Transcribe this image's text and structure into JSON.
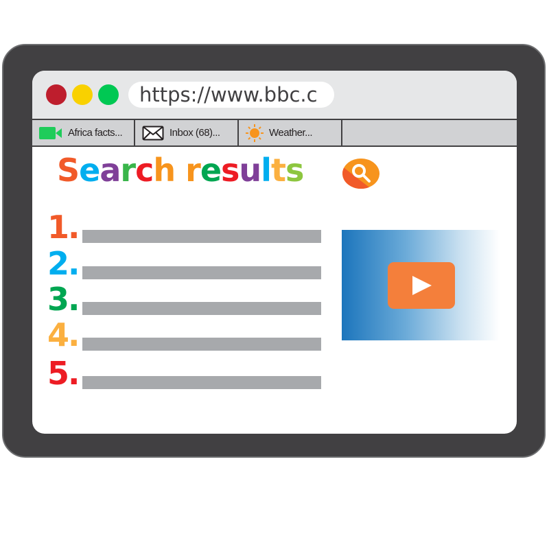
{
  "window": {
    "controls": [
      {
        "name": "close",
        "color": "#be1e2d"
      },
      {
        "name": "minimize",
        "color": "#f9d100"
      },
      {
        "name": "maximize",
        "color": "#00c853"
      }
    ],
    "url": "https://www.bbc.c"
  },
  "tabs": [
    {
      "icon": "video-camera-icon",
      "label": "Africa facts...",
      "icon_color": "#1fcc5a"
    },
    {
      "icon": "envelope-icon",
      "label": "Inbox (68)...",
      "icon_color": "#231f20"
    },
    {
      "icon": "sun-icon",
      "label": "Weather...",
      "icon_color": "#f7941d"
    }
  ],
  "heading": {
    "text": "Search results",
    "letters": [
      {
        "ch": "S",
        "color": "#f15a29"
      },
      {
        "ch": "e",
        "color": "#00aeef"
      },
      {
        "ch": "a",
        "color": "#7f3f98"
      },
      {
        "ch": "r",
        "color": "#39b54a"
      },
      {
        "ch": "c",
        "color": "#ed1c24"
      },
      {
        "ch": "h",
        "color": "#f7941d"
      },
      {
        "ch": " ",
        "color": "#ffffff"
      },
      {
        "ch": "r",
        "color": "#f7941d"
      },
      {
        "ch": "e",
        "color": "#00a651"
      },
      {
        "ch": "s",
        "color": "#ed1c24"
      },
      {
        "ch": "u",
        "color": "#7f3f98"
      },
      {
        "ch": "l",
        "color": "#00aeef"
      },
      {
        "ch": "t",
        "color": "#fbb040"
      },
      {
        "ch": "s",
        "color": "#8dc63f"
      }
    ],
    "search_icon": "search-icon"
  },
  "results": [
    {
      "number": "1.",
      "color": "#f15a29"
    },
    {
      "number": "2.",
      "color": "#00aeef"
    },
    {
      "number": "3.",
      "color": "#00a651"
    },
    {
      "number": "4.",
      "color": "#fbb040"
    },
    {
      "number": "5.",
      "color": "#ed1c24"
    }
  ],
  "video": {
    "icon": "play-icon",
    "button_color": "#f47f3b"
  }
}
